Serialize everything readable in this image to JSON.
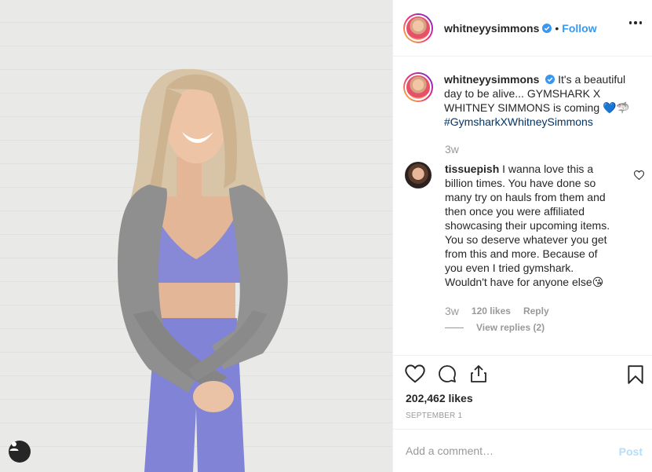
{
  "post": {
    "username": "whitneyysimmons",
    "dot": "•",
    "follow_label": "Follow",
    "caption_text": "It's a beautiful day to be alive... GYMSHARK X WHITNEY SIMMONS is coming 💙🦈",
    "hashtag": "#GymsharkXWhitneySimmons",
    "caption_time": "3w",
    "likes": "202,462 likes",
    "date": "SEPTEMBER 1"
  },
  "comment": {
    "username": "tissuepish",
    "text": "I wanna love this a billion times. You have done so many try on hauls from them and then once you were affiliated showcasing their upcoming items. You so deserve whatever you get from this and more. Because of you even I tried gymshark. Wouldn't have for anyone else😘",
    "time": "3w",
    "likes": "120 likes",
    "reply_label": "Reply",
    "view_replies": "View replies (2)"
  },
  "add_comment": {
    "placeholder": "Add a comment…",
    "post_label": "Post"
  },
  "colors": {
    "link": "#3897f0",
    "hashtag": "#003569",
    "muted": "#999999",
    "post_disabled": "#b2dffc"
  },
  "icons": [
    "user-tag-icon",
    "verified-icon",
    "more-options-icon",
    "heart-icon",
    "comment-icon",
    "share-icon",
    "bookmark-icon",
    "like-comment-icon"
  ]
}
